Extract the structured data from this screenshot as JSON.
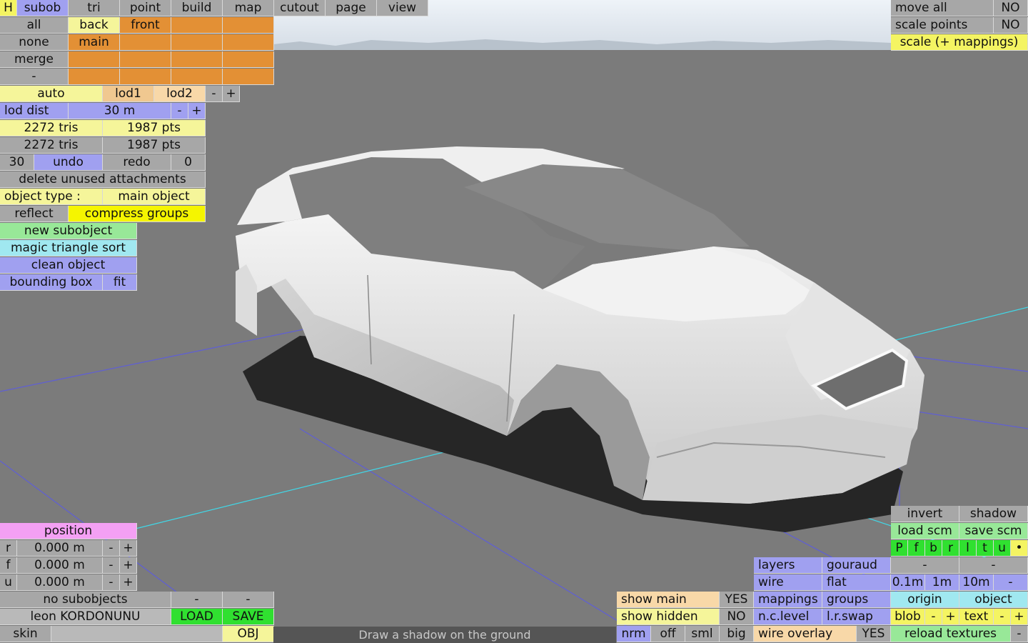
{
  "menu": {
    "h": "H",
    "tabs": [
      "subob",
      "tri",
      "point",
      "build",
      "map",
      "cutout",
      "page",
      "view"
    ]
  },
  "views": {
    "all": "all",
    "back": "back",
    "front": "front",
    "none": "none",
    "main": "main",
    "merge": "merge",
    "dash": "-"
  },
  "lod": {
    "auto": "auto",
    "lod1": "lod1",
    "lod2": "lod2",
    "minus": "-",
    "plus": "+",
    "dist_label": "lod dist",
    "dist_value": "30 m"
  },
  "stats": {
    "tris1": "2272 tris",
    "pts1": "1987 pts",
    "tris2": "2272 tris",
    "pts2": "1987 pts"
  },
  "undo": {
    "count": "30",
    "undo": "undo",
    "redo": "redo",
    "redo_count": "0"
  },
  "actions": {
    "delete_unused": "delete unused attachments",
    "object_type_label": "object type :",
    "object_type_value": "main object",
    "reflect": "reflect",
    "compress": "compress groups",
    "new_subobject": "new subobject",
    "magic_sort": "magic triangle sort",
    "clean_object": "clean object",
    "bounding_box": "bounding box",
    "fit": "fit"
  },
  "position": {
    "title": "position",
    "rows": [
      {
        "axis": "r",
        "value": "0.000 m"
      },
      {
        "axis": "f",
        "value": "0.000 m"
      },
      {
        "axis": "u",
        "value": "0.000 m"
      }
    ],
    "minus": "-",
    "plus": "+"
  },
  "bottom_left": {
    "no_subobjects": "no subobjects",
    "dash": "-",
    "file_name": "leon KORDONUNU",
    "load": "LOAD",
    "save": "SAVE",
    "skin": "skin",
    "obj": "OBJ"
  },
  "status": "Draw a shadow on the ground",
  "top_right": {
    "move_all": "move all",
    "move_all_val": "NO",
    "scale_points": "scale points",
    "scale_points_val": "NO",
    "scale_mappings": "scale (+ mappings)"
  },
  "display": {
    "show_main": "show main",
    "show_main_val": "YES",
    "show_hidden": "show hidden",
    "show_hidden_val": "NO",
    "nrm": "nrm",
    "off": "off",
    "sml": "sml",
    "big": "big",
    "layers": "layers",
    "gouraud": "gouraud",
    "wire": "wire",
    "flat": "flat",
    "mappings": "mappings",
    "groups": "groups",
    "nc_level": "n.c.level",
    "lr_swap": "l.r.swap",
    "wire_overlay": "wire overlay",
    "wire_overlay_val": "YES"
  },
  "right_panel": {
    "invert": "invert",
    "shadow": "shadow",
    "load_scm": "load scm",
    "save_scm": "save scm",
    "views": [
      "P",
      "f",
      "b",
      "r",
      "l",
      "t",
      "u",
      "•"
    ],
    "dash": "-",
    "g1": "0.1m",
    "g2": "1m",
    "g3": "10m",
    "origin": "origin",
    "object": "object",
    "blob": "blob",
    "text": "text",
    "minus": "-",
    "plus": "+",
    "reload": "reload textures",
    "dash2": "-"
  },
  "colors": {
    "orange": "#e39035",
    "blue": "#a0a0f0",
    "yellow": "#f5f59a",
    "green": "#98e898",
    "cyan": "#a0e8f0",
    "pink": "#f4a0f4"
  }
}
